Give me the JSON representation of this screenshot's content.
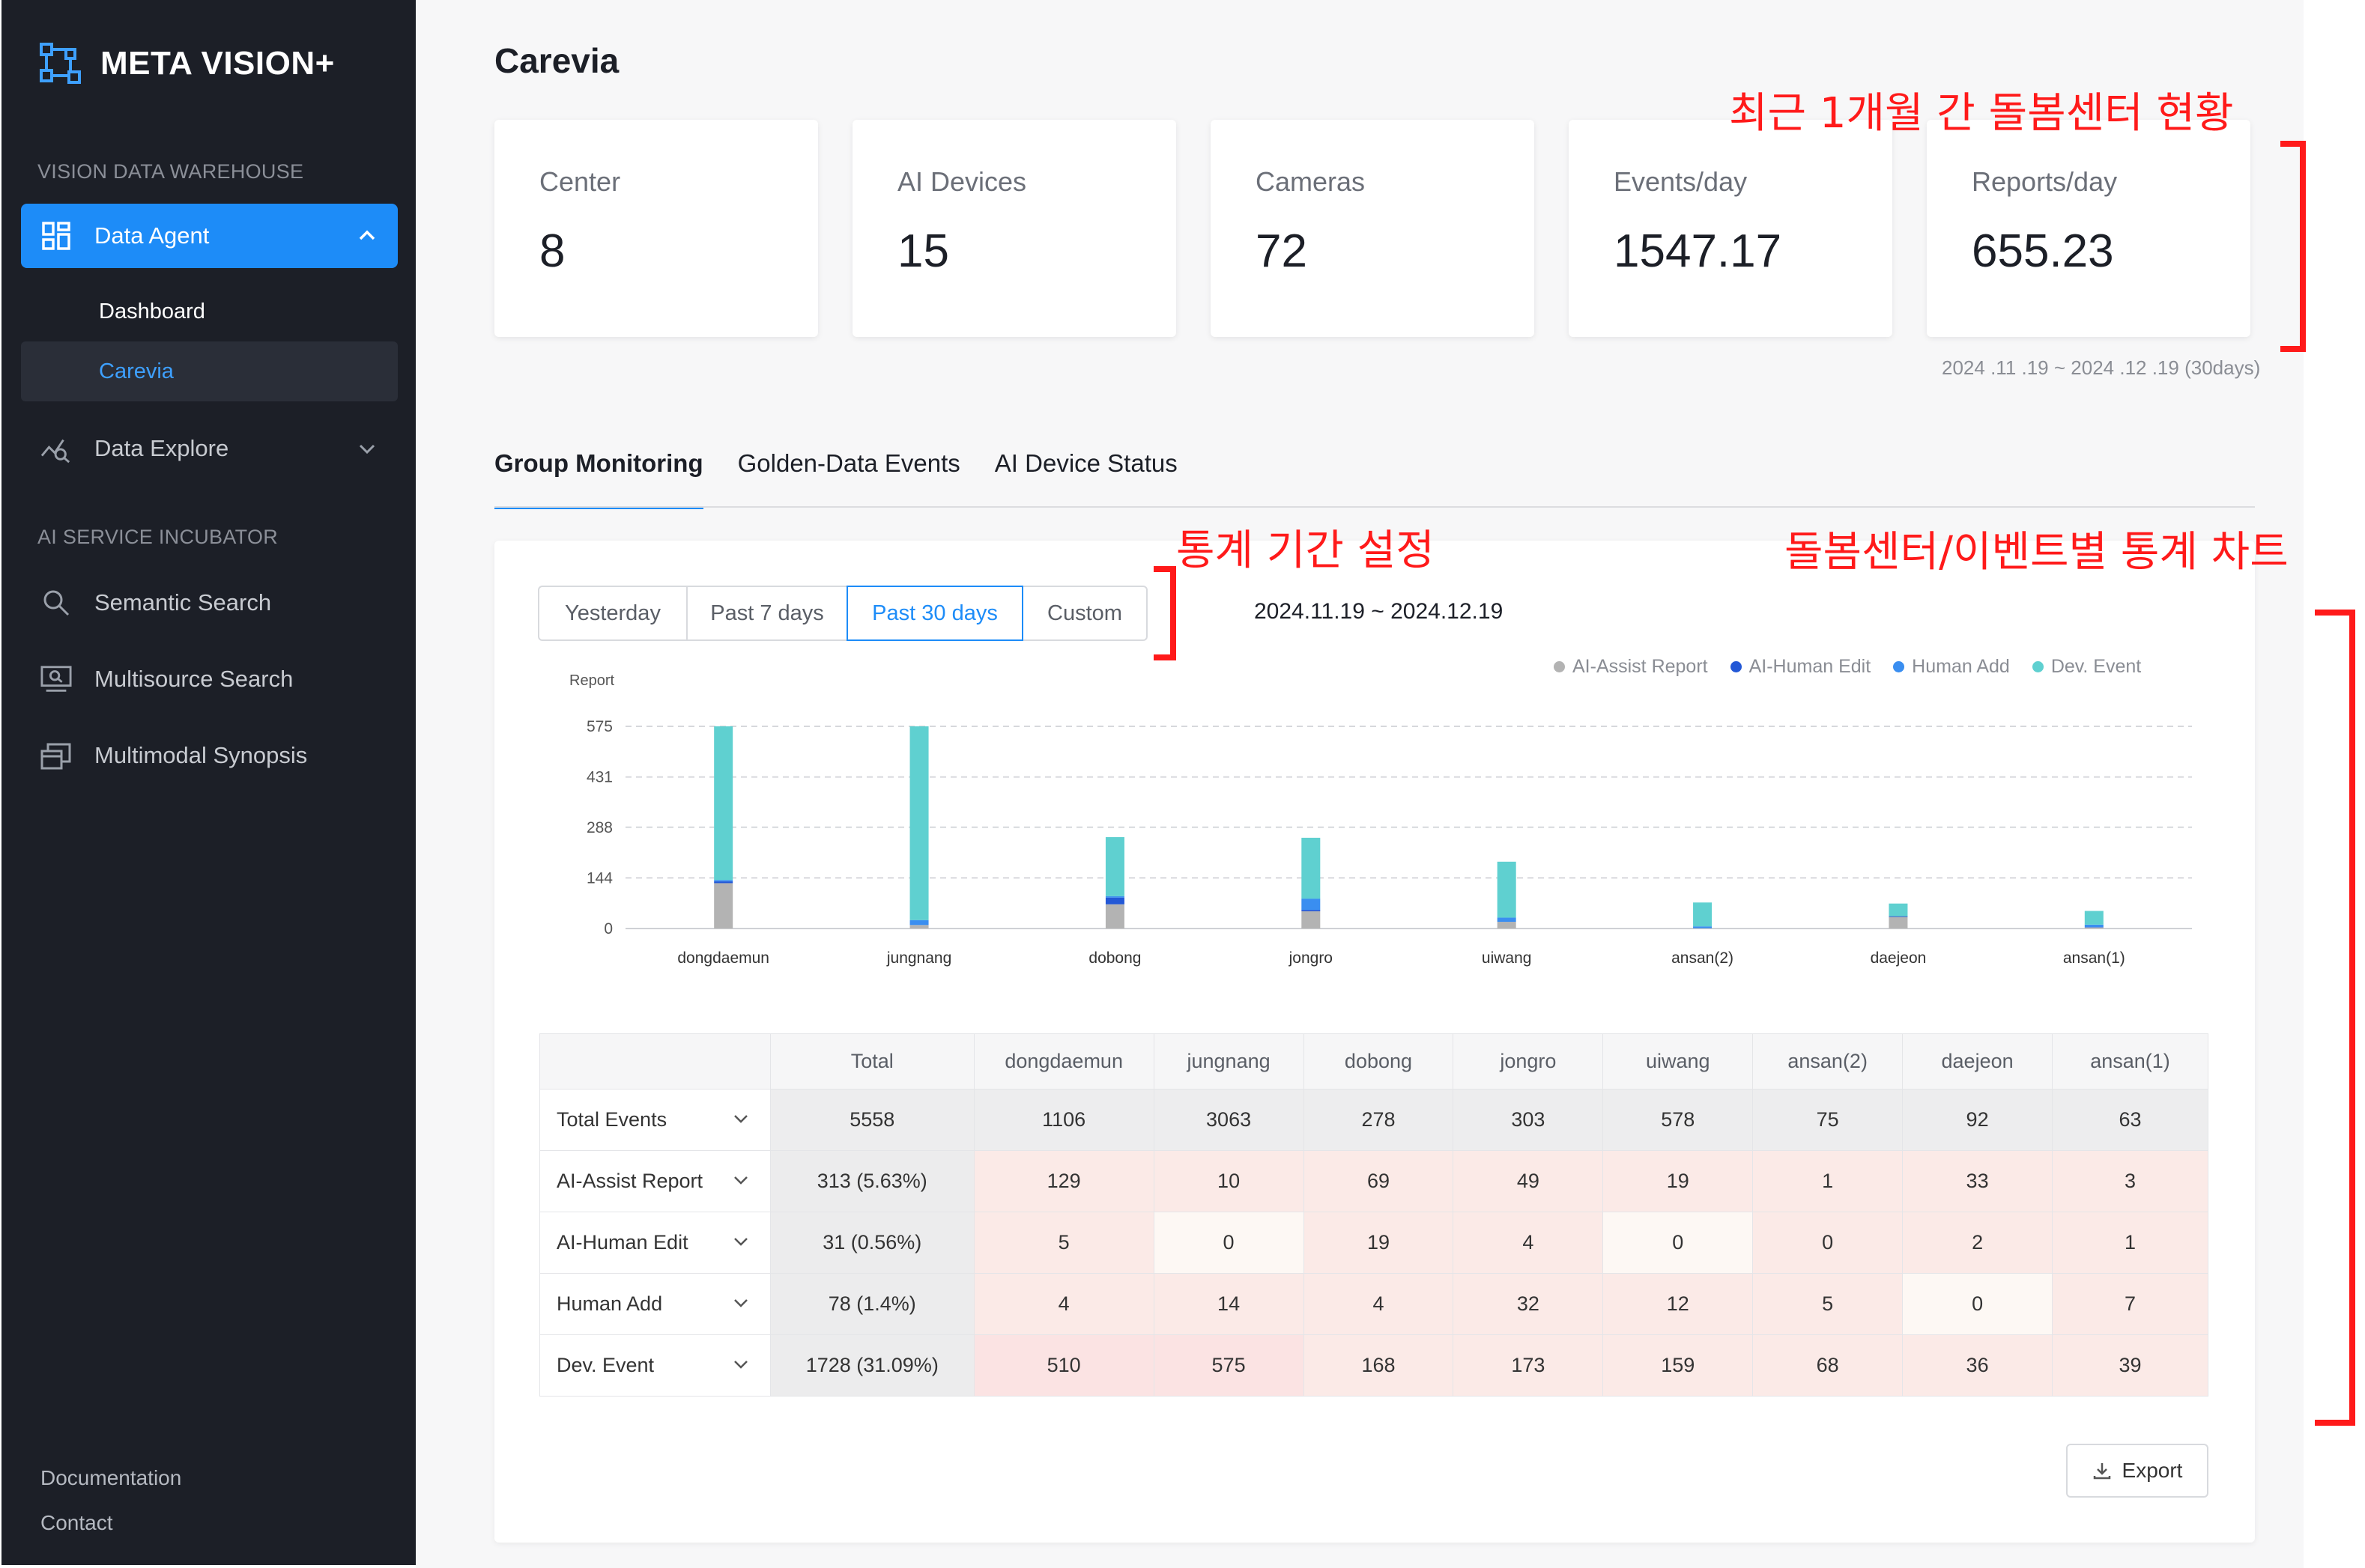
{
  "brand": {
    "name": "META VISION+"
  },
  "sidebar": {
    "sections": {
      "warehouse": "VISION DATA WAREHOUSE",
      "incubator": "AI SERVICE INCUBATOR"
    },
    "data_agent": "Data Agent",
    "sub_items": [
      "Dashboard",
      "Carevia"
    ],
    "data_explore": "Data Explore",
    "services": [
      "Semantic Search",
      "Multisource Search",
      "Multimodal Synopsis"
    ],
    "footer": [
      "Documentation",
      "Contact"
    ]
  },
  "page": {
    "title": "Carevia"
  },
  "stats": [
    {
      "label": "Center",
      "value": "8"
    },
    {
      "label": "AI Devices",
      "value": "15"
    },
    {
      "label": "Cameras",
      "value": "72"
    },
    {
      "label": "Events/day",
      "value": "1547.17"
    },
    {
      "label": "Reports/day",
      "value": "655.23"
    }
  ],
  "period_note": "2024 .11 .19 ~ 2024 .12 .19 (30days)",
  "tabs": [
    "Group Monitoring",
    "Golden-Data Events",
    "AI Device Status"
  ],
  "range_buttons": [
    "Yesterday",
    "Past 7 days",
    "Past 30 days",
    "Custom"
  ],
  "range_selected": "Past 30 days",
  "date_range": "2024.11.19 ~ 2024.12.19",
  "colors": {
    "ai_assist": "#b3b3b3",
    "ai_human": "#2358d6",
    "human_add": "#3a8ef0",
    "dev_event": "#5fd0d0",
    "accent": "#1d8cf8",
    "annotation": "#ff1a1a"
  },
  "chart_data": {
    "type": "bar",
    "stacked": true,
    "ylabel": "Report",
    "yticks": [
      0,
      144,
      288,
      431,
      575
    ],
    "ylim": [
      0,
      575
    ],
    "grid": true,
    "legend_position": "top-right",
    "categories": [
      "dongdaemun",
      "jungnang",
      "dobong",
      "jongro",
      "uiwang",
      "ansan(2)",
      "daejeon",
      "ansan(1)"
    ],
    "series": [
      {
        "name": "AI-Assist Report",
        "color": "#b3b3b3",
        "values": [
          129,
          10,
          69,
          49,
          19,
          1,
          33,
          3
        ]
      },
      {
        "name": "AI-Human Edit",
        "color": "#2358d6",
        "values": [
          5,
          0,
          19,
          4,
          0,
          0,
          2,
          1
        ]
      },
      {
        "name": "Human Add",
        "color": "#3a8ef0",
        "values": [
          4,
          14,
          4,
          32,
          12,
          5,
          0,
          7
        ]
      },
      {
        "name": "Dev. Event",
        "color": "#5fd0d0",
        "values": [
          510,
          575,
          168,
          173,
          159,
          68,
          36,
          39
        ]
      }
    ]
  },
  "table": {
    "headers": [
      "Total",
      "dongdaemun",
      "jungnang",
      "dobong",
      "jongro",
      "uiwang",
      "ansan(2)",
      "daejeon",
      "ansan(1)"
    ],
    "rows": [
      {
        "label": "Total Events",
        "total": "5558",
        "cells": [
          "1106",
          "3063",
          "278",
          "303",
          "578",
          "75",
          "92",
          "63"
        ]
      },
      {
        "label": "AI-Assist Report",
        "total": "313 (5.63%)",
        "cells": [
          "129",
          "10",
          "69",
          "49",
          "19",
          "1",
          "33",
          "3"
        ]
      },
      {
        "label": "AI-Human Edit",
        "total": "31 (0.56%)",
        "cells": [
          "5",
          "0",
          "19",
          "4",
          "0",
          "0",
          "2",
          "1"
        ]
      },
      {
        "label": "Human Add",
        "total": "78 (1.4%)",
        "cells": [
          "4",
          "14",
          "4",
          "32",
          "12",
          "5",
          "0",
          "7"
        ]
      },
      {
        "label": "Dev. Event",
        "total": "1728 (31.09%)",
        "cells": [
          "510",
          "575",
          "168",
          "173",
          "159",
          "68",
          "36",
          "39"
        ]
      }
    ]
  },
  "export_label": "Export",
  "annotations": {
    "status": "최근 1개월 간 돌봄센터 현황",
    "period": "통계 기간 설정",
    "chart": "돌봄센터/이벤트별 통계 차트"
  }
}
